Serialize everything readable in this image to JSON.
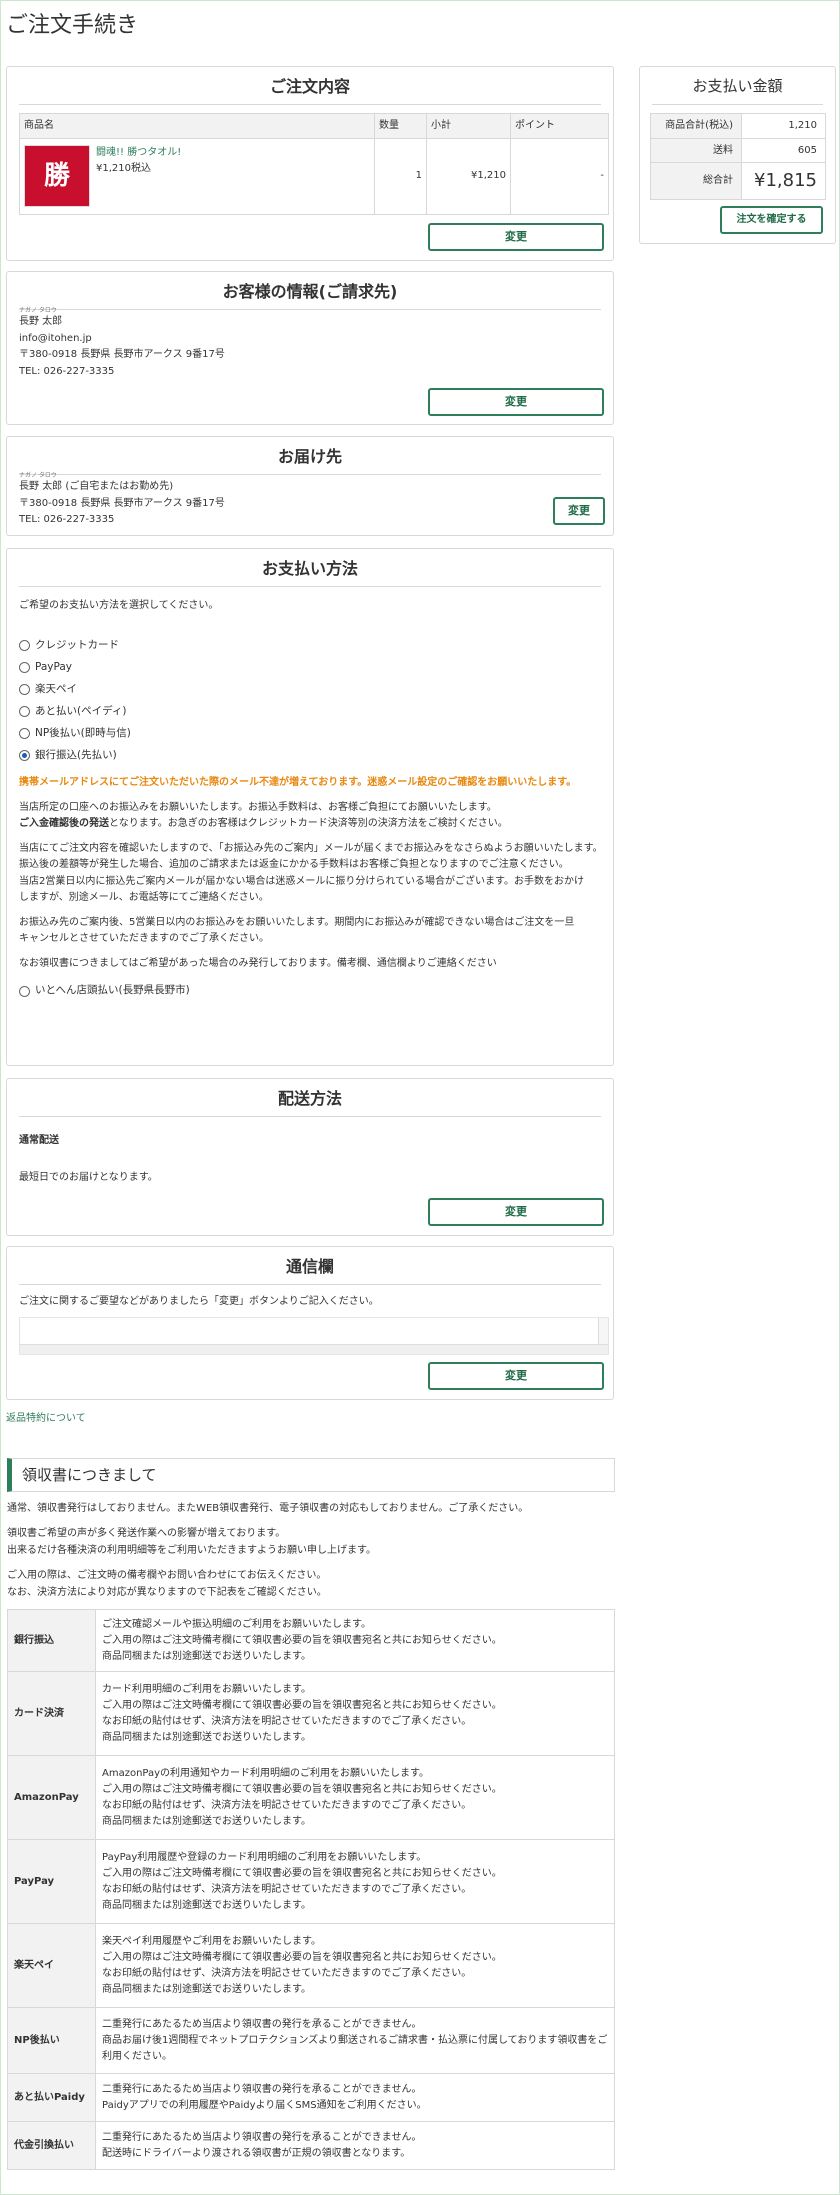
{
  "page": {
    "title": "ご注文手続き"
  },
  "order": {
    "heading": "ご注文内容",
    "cols": [
      "商品名",
      "数量",
      "小計",
      "ポイント"
    ],
    "item": {
      "thumb_text": "勝",
      "name": "闘魂!! 勝つタオル!",
      "price": "¥1,210税込",
      "qty": "1",
      "subtotal": "¥1,210",
      "points": "-"
    },
    "change": "変更"
  },
  "customer": {
    "heading": "お客様の情報(ご請求先)",
    "kana": "ナガノ タロウ",
    "name": "長野 太郎",
    "email": "info@itohen.jp",
    "address": "〒380-0918 長野県 長野市アークス 9番17号",
    "tel": "TEL: 026-227-3335",
    "change": "変更"
  },
  "delivery": {
    "heading": "お届け先",
    "kana": "ナガノ タロウ",
    "name": "長野 太郎 (ご自宅またはお勤め先)",
    "address": "〒380-0918 長野県 長野市アークス 9番17号",
    "tel": "TEL: 026-227-3335",
    "change": "変更"
  },
  "payment": {
    "heading": "お支払い方法",
    "prompt": "ご希望のお支払い方法を選択してください。",
    "options": [
      "クレジットカード",
      "PayPay",
      "楽天ペイ",
      "あと払い(ペイディ)",
      "NP後払い(即時与信)",
      "銀行振込(先払い)"
    ],
    "selected_index": 5,
    "warning": "携帯メールアドレスにてご注文いただいた際のメール不達が増えております。迷惑メール設定のご確認をお願いいたします。",
    "p1": "当店所定の口座へのお振込みをお願いいたします。お振込手数料は、お客様ご負担にてお願いいたします。",
    "p1b": "ご入金確認後の発送",
    "p1c": "となります。お急ぎのお客様はクレジットカード決済等別の決済方法をご検討ください。",
    "p2": "当店にてご注文内容を確認いたしますので、「お振込み先のご案内」メールが届くまでお振込みをなさらぬようお願いいたします。",
    "p3": "振込後の差額等が発生した場合、追加のご請求または返金にかかる手数料はお客様ご負担となりますのでご注意ください。",
    "p4": "当店2営業日以内に振込先ご案内メールが届かない場合は迷惑メールに振り分けられている場合がございます。お手数をおかけ",
    "p5": "しますが、別途メール、お電話等にてご連絡ください。",
    "p6": "お振込み先のご案内後、5営業日以内のお振込みをお願いいたします。期間内にお振込みが確認できない場合はご注文を一旦",
    "p7": "キャンセルとさせていただきますのでご了承ください。",
    "p8": "なお領収書につきましてはご希望があった場合のみ発行しております。備考欄、通信欄よりご連絡ください",
    "store_option": "いとへん店頭払い(長野県長野市)"
  },
  "shipping": {
    "heading": "配送方法",
    "method": "通常配送",
    "note": "最短日でのお届けとなります。",
    "change": "変更"
  },
  "message": {
    "heading": "通信欄",
    "prompt": "ご注文に関するご要望などがありましたら「変更」ボタンよりご記入ください。",
    "change": "変更"
  },
  "links": {
    "returns": "返品特約について"
  },
  "summary": {
    "heading": "お支払い金額",
    "rows": [
      {
        "k": "商品合計(税込)",
        "v": "1,210"
      },
      {
        "k": "送料",
        "v": "605"
      }
    ],
    "total_label": "総合計",
    "total": "¥1,815",
    "confirm": "注文を確定する"
  },
  "receipt": {
    "heading": "領収書につきまして",
    "intro1": "通常、領収書発行はしておりません。またWEB領収書発行、電子領収書の対応もしておりません。ご了承ください。",
    "intro2": "領収書ご希望の声が多く発送作業への影響が増えております。",
    "intro3": "出来るだけ各種決済の利用明細等をご利用いただきますようお願い申し上げます。",
    "intro4": "ご入用の際は、ご注文時の備考欄やお問い合わせにてお伝えください。",
    "intro5": "なお、決済方法により対応が異なりますので下記表をご確認ください。",
    "rows": [
      {
        "k": "銀行振込",
        "lines": [
          "ご注文確認メールや振込明細のご利用をお願いいたします。",
          "ご入用の際はご注文時備考欄にて領収書必要の旨を領収書宛名と共にお知らせください。",
          "商品同梱または別途郵送でお送りいたします。"
        ]
      },
      {
        "k": "カード決済",
        "lines": [
          "カード利用明細のご利用をお願いいたします。",
          "ご入用の際はご注文時備考欄にて領収書必要の旨を領収書宛名と共にお知らせください。",
          "なお印紙の貼付はせず、決済方法を明記させていただきますのでご了承ください。",
          "商品同梱または別途郵送でお送りいたします。"
        ]
      },
      {
        "k": "AmazonPay",
        "lines": [
          "AmazonPayの利用通知やカード利用明細のご利用をお願いいたします。",
          "ご入用の際はご注文時備考欄にて領収書必要の旨を領収書宛名と共にお知らせください。",
          "なお印紙の貼付はせず、決済方法を明記させていただきますのでご了承ください。",
          "商品同梱または別途郵送でお送りいたします。"
        ]
      },
      {
        "k": "PayPay",
        "lines": [
          "PayPay利用履歴や登録のカード利用明細のご利用をお願いいたします。",
          "ご入用の際はご注文時備考欄にて領収書必要の旨を領収書宛名と共にお知らせください。",
          "なお印紙の貼付はせず、決済方法を明記させていただきますのでご了承ください。",
          "商品同梱または別途郵送でお送りいたします。"
        ]
      },
      {
        "k": "楽天ペイ",
        "lines": [
          "楽天ペイ利用履歴やご利用をお願いいたします。",
          "ご入用の際はご注文時備考欄にて領収書必要の旨を領収書宛名と共にお知らせください。",
          "なお印紙の貼付はせず、決済方法を明記させていただきますのでご了承ください。",
          "商品同梱または別途郵送でお送りいたします。"
        ]
      },
      {
        "k": "NP後払い",
        "lines": [
          "二重発行にあたるため当店より領収書の発行を承ることができません。",
          "商品お届け後1週間程でネットプロテクションズより郵送されるご請求書・払込票に付属しております領収書をご利用ください。"
        ]
      },
      {
        "k": "あと払いPaidy",
        "lines": [
          "二重発行にあたるため当店より領収書の発行を承ることができません。",
          "Paidyアプリでの利用履歴やPaidyより届くSMS通知をご利用ください。"
        ]
      },
      {
        "k": "代金引換払い",
        "lines": [
          "二重発行にあたるため当店より領収書の発行を承ることができません。",
          "配送時にドライバーより渡される領収書が正規の領収書となります。"
        ]
      }
    ]
  },
  "colors": {
    "accent": "#2e7d5b",
    "warning": "#e8880f"
  }
}
